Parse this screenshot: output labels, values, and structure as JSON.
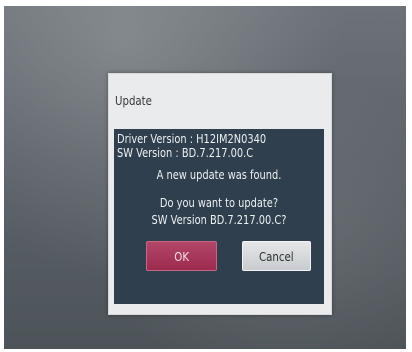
{
  "dialog": {
    "title": "Update",
    "driver_version": "Driver Version : H12IM2N0340",
    "sw_version": "SW Version :  BD.7.217.00.C",
    "message_found": "A new update was found.",
    "question": "Do you want to update?",
    "new_sw_version": "SW Version  BD.7.217.00.C?",
    "ok_label": "OK",
    "cancel_label": "Cancel"
  },
  "colors": {
    "ok_button": "#a8345a",
    "dialog_body": "#2f3f4d",
    "dialog_frame": "#e9ebec"
  }
}
